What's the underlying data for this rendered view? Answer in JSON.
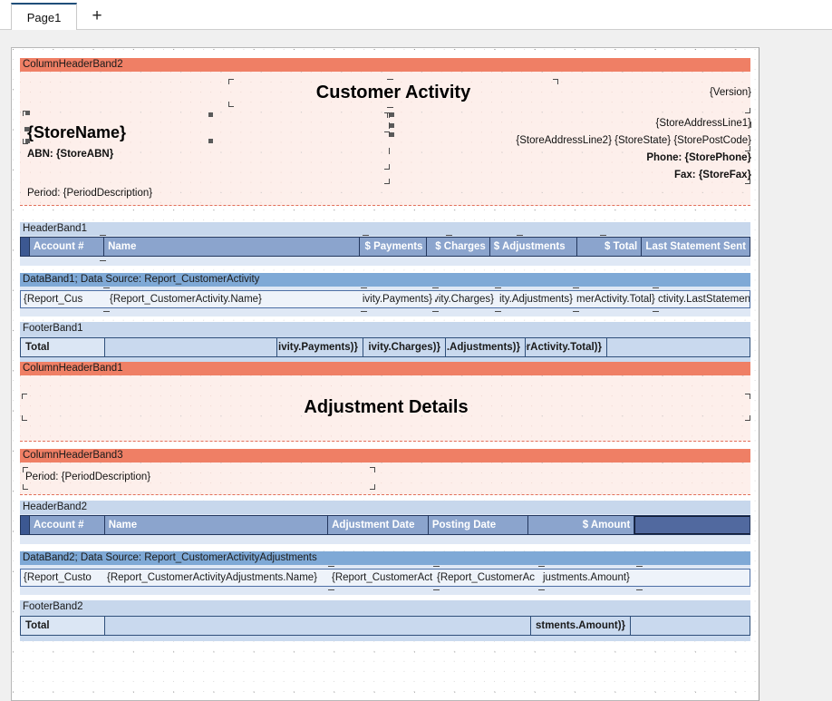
{
  "tabbar": {
    "tabs": [
      {
        "label": "Page1"
      }
    ],
    "add_label": "+"
  },
  "report": {
    "bands": {
      "columnHeaderBand2": {
        "label": "ColumnHeaderBand2",
        "title": "Customer Activity",
        "version": "{Version}",
        "store_name": "{StoreName}",
        "abn": "ABN: {StoreABN}",
        "address_line1": "{StoreAddressLine1}",
        "address_line2": "{StoreAddressLine2} {StoreState} {StorePostCode}",
        "phone": "Phone: {StorePhone}",
        "fax": "Fax: {StoreFax}",
        "period": "Period: {PeriodDescription}"
      },
      "headerBand1": {
        "label": "HeaderBand1",
        "columns": [
          {
            "label": "Account #",
            "align": "left"
          },
          {
            "label": "Name",
            "align": "left"
          },
          {
            "label": "$ Payments",
            "align": "right"
          },
          {
            "label": "$ Charges",
            "align": "right"
          },
          {
            "label": "$ Adjustments",
            "align": "left"
          },
          {
            "label": "$ Total",
            "align": "right"
          },
          {
            "label": "Last Statement Sent",
            "align": "right"
          }
        ]
      },
      "dataBand1": {
        "label": "DataBand1; Data Source: Report_CustomerActivity",
        "cells": [
          {
            "text": "{Report_Cus",
            "align": "left"
          },
          {
            "text": "{Report_CustomerActivity.Name}",
            "align": "left"
          },
          {
            "text": "ctivity.Payments}",
            "align": "right"
          },
          {
            "text": "ctivity.Charges}",
            "align": "right"
          },
          {
            "text": "ity.Adjustments}",
            "align": "left"
          },
          {
            "text": "merActivity.Total}",
            "align": "left"
          },
          {
            "text": "ctivity.LastStatementSent}",
            "align": "left"
          }
        ]
      },
      "footerBand1": {
        "label": "FooterBand1",
        "cells": [
          {
            "text": "Total",
            "align": "left"
          },
          {
            "text": "",
            "align": "left"
          },
          {
            "text": "ivity.Payments)}",
            "align": "right"
          },
          {
            "text": "ivity.Charges)}",
            "align": "right"
          },
          {
            "text": ".Adjustments)}",
            "align": "right"
          },
          {
            "text": "erActivity.Total)}",
            "align": "right"
          },
          {
            "text": "",
            "align": "left"
          }
        ]
      },
      "columnHeaderBand1": {
        "label": "ColumnHeaderBand1",
        "title": "Adjustment Details"
      },
      "columnHeaderBand3": {
        "label": "ColumnHeaderBand3",
        "period": "Period: {PeriodDescription}"
      },
      "headerBand2": {
        "label": "HeaderBand2",
        "columns": [
          {
            "label": "Account #",
            "align": "left"
          },
          {
            "label": "Name",
            "align": "left"
          },
          {
            "label": "Adjustment Date",
            "align": "left"
          },
          {
            "label": "Posting Date",
            "align": "left"
          },
          {
            "label": "$ Amount",
            "align": "right"
          },
          {
            "label": "",
            "align": "left"
          }
        ]
      },
      "dataBand2": {
        "label": "DataBand2; Data Source: Report_CustomerActivityAdjustments",
        "cells": [
          {
            "text": "{Report_Custo",
            "align": "left"
          },
          {
            "text": "{Report_CustomerActivityAdjustments.Name}",
            "align": "left"
          },
          {
            "text": "{Report_CustomerAct",
            "align": "left"
          },
          {
            "text": "{Report_CustomerAc",
            "align": "left"
          },
          {
            "text": "justments.Amount}",
            "align": "left"
          },
          {
            "text": "",
            "align": "left"
          }
        ]
      },
      "footerBand2": {
        "label": "FooterBand2",
        "cells": [
          {
            "text": "Total",
            "align": "left"
          },
          {
            "text": "",
            "align": "left"
          },
          {
            "text": "stments.Amount)}",
            "align": "right"
          },
          {
            "text": "",
            "align": "left"
          }
        ]
      }
    }
  },
  "colors": {
    "band_coral": "#ef7f65",
    "band_light_blue": "#c7d7ec",
    "band_mid_blue": "#7fa9d6",
    "header_cell": "#8ba4cd",
    "header_cell_selected": "#51699f",
    "footer_cell": "#c9d9ee",
    "tab_accent": "#1f4e79"
  }
}
